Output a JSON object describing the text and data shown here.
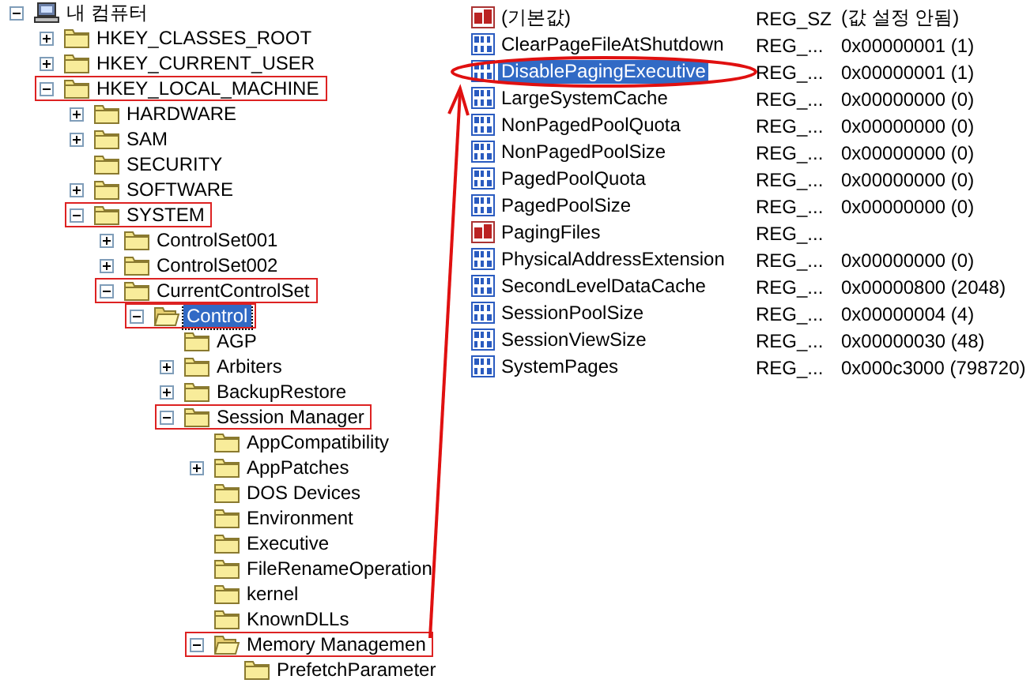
{
  "tree": {
    "label": "내 컴퓨터",
    "kind": "computer",
    "expanded": true,
    "selected": false,
    "children": [
      {
        "label": "HKEY_CLASSES_ROOT",
        "kind": "folder",
        "expanded": false,
        "selected": false
      },
      {
        "label": "HKEY_CURRENT_USER",
        "kind": "folder",
        "expanded": false,
        "selected": false
      },
      {
        "label": "HKEY_LOCAL_MACHINE",
        "kind": "folder",
        "expanded": true,
        "selected": false,
        "highlighted": true,
        "children": [
          {
            "label": "HARDWARE",
            "kind": "folder",
            "expanded": false,
            "selected": false
          },
          {
            "label": "SAM",
            "kind": "folder",
            "expanded": false,
            "selected": false
          },
          {
            "label": "SECURITY",
            "kind": "folder",
            "selected": false
          },
          {
            "label": "SOFTWARE",
            "kind": "folder",
            "expanded": false,
            "selected": false
          },
          {
            "label": "SYSTEM",
            "kind": "folder",
            "expanded": true,
            "selected": false,
            "highlighted": true,
            "children": [
              {
                "label": "ControlSet001",
                "kind": "folder",
                "expanded": false,
                "selected": false
              },
              {
                "label": "ControlSet002",
                "kind": "folder",
                "expanded": false,
                "selected": false
              },
              {
                "label": "CurrentControlSet",
                "kind": "folder",
                "expanded": true,
                "selected": false,
                "highlighted": true,
                "children": [
                  {
                    "label": "Control",
                    "kind": "open-folder",
                    "expanded": true,
                    "selected": true,
                    "highlighted": true,
                    "children": [
                      {
                        "label": "AGP",
                        "kind": "folder",
                        "selected": false
                      },
                      {
                        "label": "Arbiters",
                        "kind": "folder",
                        "expanded": false,
                        "selected": false
                      },
                      {
                        "label": "BackupRestore",
                        "kind": "folder",
                        "expanded": false,
                        "selected": false
                      },
                      {
                        "label": "Session Manager",
                        "kind": "folder",
                        "expanded": true,
                        "selected": false,
                        "highlighted": true,
                        "children": [
                          {
                            "label": "AppCompatibility",
                            "kind": "folder",
                            "selected": false
                          },
                          {
                            "label": "AppPatches",
                            "kind": "folder",
                            "expanded": false,
                            "selected": false
                          },
                          {
                            "label": "DOS Devices",
                            "kind": "folder",
                            "selected": false
                          },
                          {
                            "label": "Environment",
                            "kind": "folder",
                            "selected": false
                          },
                          {
                            "label": "Executive",
                            "kind": "folder",
                            "selected": false
                          },
                          {
                            "label": "FileRenameOperation",
                            "kind": "folder",
                            "selected": false
                          },
                          {
                            "label": "kernel",
                            "kind": "folder",
                            "selected": false
                          },
                          {
                            "label": "KnownDLLs",
                            "kind": "folder",
                            "selected": false
                          },
                          {
                            "label": "Memory Managemen",
                            "kind": "open-folder",
                            "expanded": true,
                            "selected": false,
                            "highlighted": true,
                            "children": [
                              {
                                "label": "PrefetchParameter",
                                "kind": "folder",
                                "selected": false
                              }
                            ]
                          }
                        ]
                      }
                    ]
                  }
                ]
              }
            ]
          }
        ]
      }
    ]
  },
  "values": {
    "rows": [
      {
        "kind": "string",
        "name": "(기본값)",
        "type": "REG_SZ",
        "data": "(값 설정 안됨)",
        "selected": false
      },
      {
        "kind": "binary",
        "name": "ClearPageFileAtShutdown",
        "type": "REG_...",
        "data": "0x00000001 (1)",
        "selected": false
      },
      {
        "kind": "binary",
        "name": "DisablePagingExecutive",
        "type": "REG_...",
        "data": "0x00000001 (1)",
        "selected": true,
        "highlighted": true
      },
      {
        "kind": "binary",
        "name": "LargeSystemCache",
        "type": "REG_...",
        "data": "0x00000000 (0)",
        "selected": false
      },
      {
        "kind": "binary",
        "name": "NonPagedPoolQuota",
        "type": "REG_...",
        "data": "0x00000000 (0)",
        "selected": false
      },
      {
        "kind": "binary",
        "name": "NonPagedPoolSize",
        "type": "REG_...",
        "data": "0x00000000 (0)",
        "selected": false
      },
      {
        "kind": "binary",
        "name": "PagedPoolQuota",
        "type": "REG_...",
        "data": "0x00000000 (0)",
        "selected": false
      },
      {
        "kind": "binary",
        "name": "PagedPoolSize",
        "type": "REG_...",
        "data": "0x00000000 (0)",
        "selected": false
      },
      {
        "kind": "string",
        "name": "PagingFiles",
        "type": "REG_...",
        "selected": false
      },
      {
        "kind": "binary",
        "name": "PhysicalAddressExtension",
        "type": "REG_...",
        "data": "0x00000000 (0)",
        "selected": false
      },
      {
        "kind": "binary",
        "name": "SecondLevelDataCache",
        "type": "REG_...",
        "data": "0x00000800 (2048)",
        "selected": false
      },
      {
        "kind": "binary",
        "name": "SessionPoolSize",
        "type": "REG_...",
        "data": "0x00000004 (4)",
        "selected": false
      },
      {
        "kind": "binary",
        "name": "SessionViewSize",
        "type": "REG_...",
        "data": "0x00000030 (48)",
        "selected": false
      },
      {
        "kind": "binary",
        "name": "SystemPages",
        "type": "REG_...",
        "data": "0x000c3000 (798720)",
        "selected": false
      }
    ]
  }
}
